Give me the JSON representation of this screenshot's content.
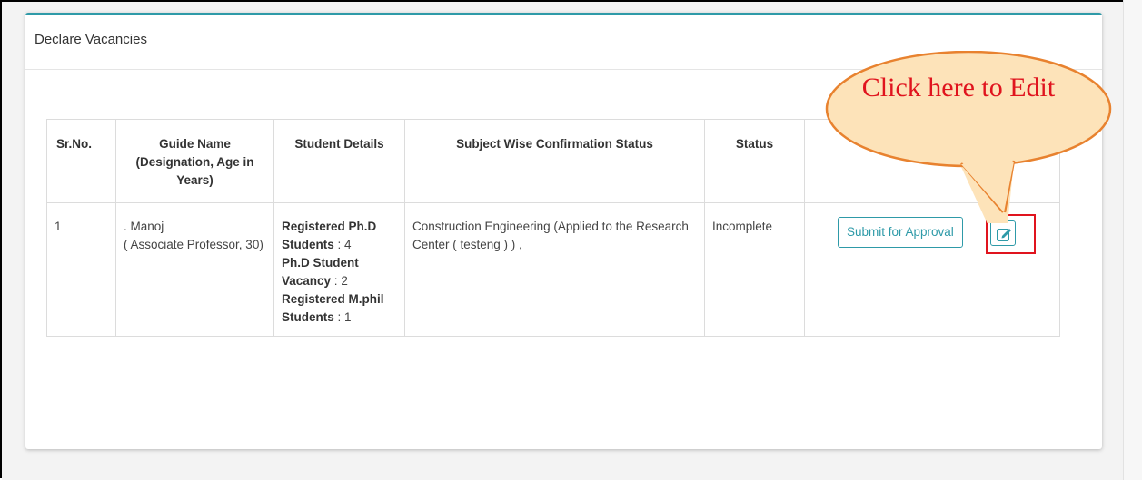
{
  "panel": {
    "title": "Declare Vacancies"
  },
  "table": {
    "headers": {
      "sr": "Sr.No.",
      "guide": "Guide Name (Designation, Age in Years)",
      "student": "Student Details",
      "subject": "Subject Wise Confirmation Status",
      "status": "Status",
      "action": ""
    },
    "rows": [
      {
        "sr": "1",
        "guide_name": ". Manoj",
        "guide_detail": "( Associate Professor, 30)",
        "registered_phd_label": "Registered Ph.D Students",
        "registered_phd_value": "4",
        "phd_vacancy_label": "Ph.D Student Vacancy",
        "phd_vacancy_value": "2",
        "registered_mphil_label": "Registered M.phil Students",
        "registered_mphil_value": "1",
        "subject": "Construction Engineering (Applied to the Research Center ( testeng ) ) ,",
        "status": "Incomplete",
        "submit_label": "Submit for Approval"
      }
    ]
  },
  "callout": {
    "text": "Click here to Edit"
  },
  "colors": {
    "accent": "#2e9aa8",
    "status_incomplete": "#e53935",
    "callout_text": "#e0141e",
    "callout_border": "#e8822f",
    "callout_fill": "#fde3b9"
  },
  "icons": {
    "edit": "edit-icon"
  }
}
